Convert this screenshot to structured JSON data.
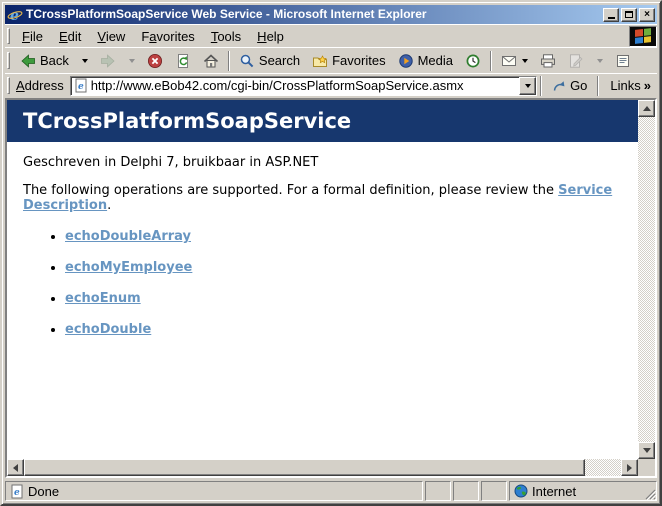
{
  "colors": {
    "chrome": "#D4D0C8",
    "titlebar_start": "#0A246A",
    "titlebar_end": "#A6CAF0",
    "header_bg": "#17376E",
    "link": "#6795C1"
  },
  "window": {
    "title": "TCrossPlatformSoapService Web Service - Microsoft Internet Explorer"
  },
  "menu": {
    "file": {
      "pre": "",
      "key": "F",
      "post": "ile"
    },
    "edit": {
      "pre": "",
      "key": "E",
      "post": "dit"
    },
    "view": {
      "pre": "",
      "key": "V",
      "post": "iew"
    },
    "favorites": {
      "pre": "F",
      "key": "a",
      "post": "vorites"
    },
    "tools": {
      "pre": "",
      "key": "T",
      "post": "ools"
    },
    "help": {
      "pre": "",
      "key": "H",
      "post": "elp"
    }
  },
  "toolbar": {
    "back_label": "Back",
    "search_label": "Search",
    "favorites_label": "Favorites",
    "media_label": "Media"
  },
  "addressbar": {
    "label": {
      "pre": "",
      "key": "A",
      "post": "ddress"
    },
    "url": "http://www.eBob42.com/cgi-bin/CrossPlatformSoapService.asmx",
    "go_label": "Go",
    "links_label": "Links",
    "chevron": "»"
  },
  "page": {
    "heading": "TCrossPlatformSoapService",
    "subtitle": "Geschreven in Delphi 7, bruikbaar in ASP.NET",
    "intro_before": "The following operations are supported. For a formal definition, please review the ",
    "intro_link": "Service Description",
    "intro_after": ".",
    "operations": [
      "echoDoubleArray",
      "echoMyEmployee",
      "echoEnum",
      "echoDouble"
    ]
  },
  "statusbar": {
    "status": "Done",
    "zone": "Internet"
  }
}
